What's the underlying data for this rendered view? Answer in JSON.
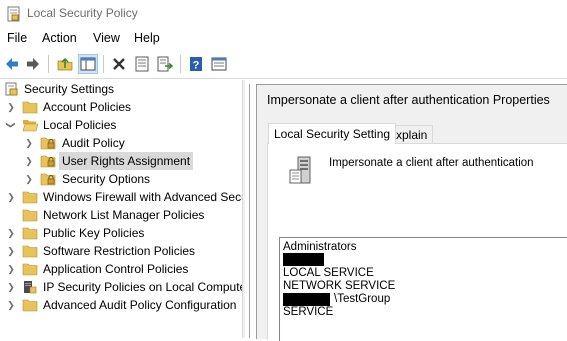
{
  "window": {
    "title": "Local Security Policy"
  },
  "menu": [
    "File",
    "Action",
    "View",
    "Help"
  ],
  "toolbar": [
    "back-arrow-icon",
    "forward-arrow-icon",
    "up-folder-icon",
    "show-hide-tree-icon",
    "delete-icon",
    "properties-icon",
    "export-list-icon",
    "help-icon",
    "console-view-icon"
  ],
  "tree": {
    "root": "Security Settings",
    "items": [
      {
        "label": "Account Policies"
      },
      {
        "label": "Local Policies"
      },
      {
        "label": "Audit Policy"
      },
      {
        "label": "User Rights Assignment"
      },
      {
        "label": "Security Options"
      },
      {
        "label": "Windows Firewall with Advanced Secu"
      },
      {
        "label": "Network List Manager Policies"
      },
      {
        "label": "Public Key Policies"
      },
      {
        "label": "Software Restriction Policies"
      },
      {
        "label": "Application Control Policies"
      },
      {
        "label": "IP Security Policies on Local Compute"
      },
      {
        "label": "Advanced Audit Policy Configuration"
      }
    ]
  },
  "dialog": {
    "title": "Impersonate a client after authentication Properties",
    "tabs": [
      "Local Security Setting",
      "Explain"
    ],
    "policy_name": "Impersonate a client after authentication",
    "entries": [
      "Administrators",
      "LOCAL SERVICE",
      "NETWORK SERVICE",
      "\\TestGroup",
      "SERVICE"
    ]
  },
  "colors": {
    "folder": "#e8c35a",
    "selection": "#d9d9d9",
    "toolbar_pressed": "#cce4f7",
    "dialog_bg": "#f0f0f0",
    "redaction": "#000000"
  }
}
